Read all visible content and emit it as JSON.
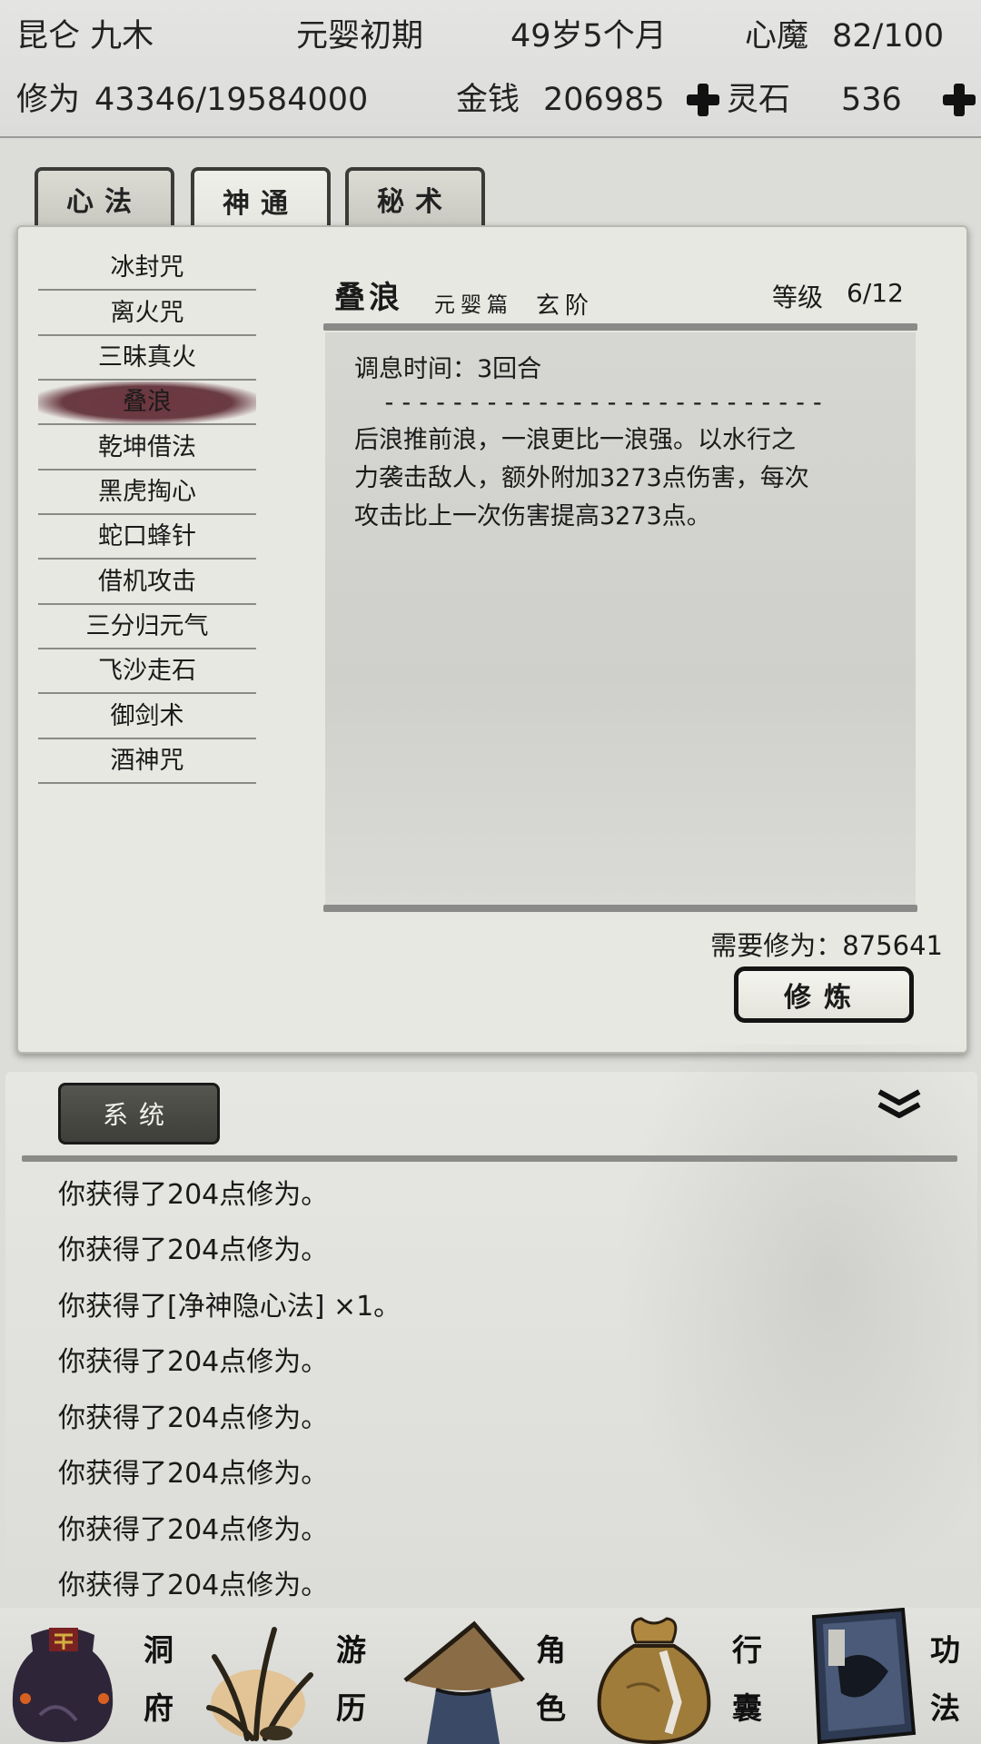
{
  "status": {
    "name": "昆仑 九木",
    "realm": "元婴初期",
    "age": "49岁5个月",
    "heart_demon_label": "心魔",
    "heart_demon_value": "82/100",
    "cultivation_label": "修为",
    "cultivation_value": "43346/19584000",
    "money_label": "金钱",
    "money_value": "206985",
    "spirit_stone_label": "灵石",
    "spirit_stone_value": "536"
  },
  "tabs": [
    "心法",
    "神通",
    "秘术"
  ],
  "active_tab": "神通",
  "skills": [
    "冰封咒",
    "离火咒",
    "三昧真火",
    "叠浪",
    "乾坤借法",
    "黑虎掏心",
    "蛇口蜂针",
    "借机攻击",
    "三分归元气",
    "飞沙走石",
    "御剑术",
    "酒神咒"
  ],
  "selected_skill": "叠浪",
  "detail": {
    "name": "叠浪",
    "chapter": "元婴篇",
    "grade": "玄阶",
    "level_label": "等级",
    "level_value": "6/12",
    "cooldown": "调息时间：3回合",
    "separator": "--------------------------",
    "description_lines": [
      "后浪推前浪，一浪更比一浪强。以水行之",
      "力袭击敌人，额外附加3273点伤害，每次",
      "攻击比上一次伤害提高3273点。"
    ],
    "required_label": "需要修为：",
    "required_value": "875641",
    "train_button": "修炼"
  },
  "log": {
    "tab_label": "系统",
    "lines": [
      "你获得了204点修为。",
      "你获得了204点修为。",
      "你获得了[净神隐心法] ×1。",
      "你获得了204点修为。",
      "你获得了204点修为。",
      "你获得了204点修为。",
      "你获得了204点修为。",
      "你获得了204点修为。"
    ]
  },
  "nav": [
    {
      "top": "洞",
      "bottom": "府"
    },
    {
      "top": "游",
      "bottom": "历"
    },
    {
      "top": "角",
      "bottom": "色"
    },
    {
      "top": "行",
      "bottom": "囊"
    },
    {
      "top": "功",
      "bottom": "法"
    }
  ],
  "colors": {
    "selected_skill_brush": "#6e3640",
    "button_border": "#141414",
    "system_tab": "#4a4a46"
  }
}
